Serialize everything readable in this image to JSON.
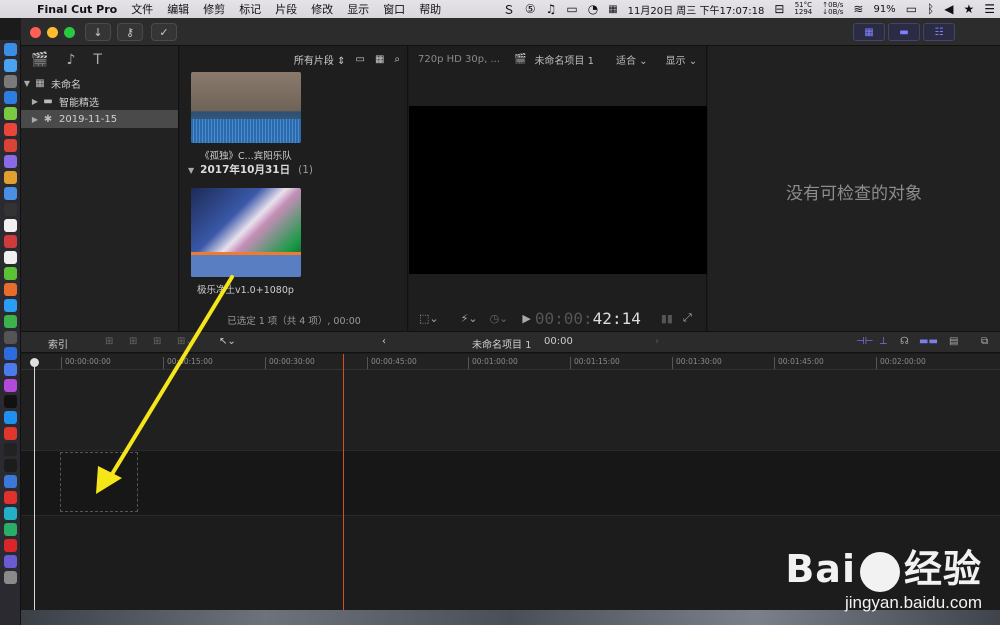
{
  "menubar": {
    "app_name": "Final Cut Pro",
    "items": [
      "文件",
      "编辑",
      "修剪",
      "标记",
      "片段",
      "修改",
      "显示",
      "窗口",
      "帮助"
    ],
    "status": {
      "temp": "51°C",
      "fan": "1294",
      "net_up": "↑0B/s",
      "net_down": "↓0B/s",
      "datetime": "11月20日 周三 下午17:07:18",
      "battery": "91%"
    }
  },
  "library": {
    "root": "未命名",
    "items": [
      {
        "label": "智能精选",
        "icon": "folder-icon"
      },
      {
        "label": "2019-11-15",
        "icon": "event-star-icon",
        "selected": true
      }
    ]
  },
  "browser": {
    "filter": "所有片段",
    "clip1_label": "《孤独》C...宾阳乐队",
    "date_group": "2017年10月31日",
    "date_count": "(1)",
    "clip2_label": "极乐净土v1.0+1080p",
    "footer": "已选定 1 项（共 4 项）, 00:00"
  },
  "viewer": {
    "format": "720p HD 30p, ...",
    "project": "未命名项目 1",
    "fit": "适合",
    "display": "显示",
    "timecode_dim": "00:00:",
    "timecode": "42:14"
  },
  "inspector": {
    "empty_message": "没有可检查的对象"
  },
  "timeline_bar": {
    "index": "索引",
    "project": "未命名项目 1",
    "time": "00:00"
  },
  "ruler": [
    "00:00:00:00",
    "00:00:15:00",
    "00:00:30:00",
    "00:00:45:00",
    "00:01:00:00",
    "00:01:15:00",
    "00:01:30:00",
    "00:01:45:00",
    "00:02:00:00"
  ],
  "watermark": {
    "brand_left": "Bai",
    "brand_right": "经验",
    "site": "jingyan.baidu.com"
  },
  "colors": {
    "accent": "#7b7df2",
    "playhead": "#d0531e",
    "annotation": "#f5e61a"
  }
}
